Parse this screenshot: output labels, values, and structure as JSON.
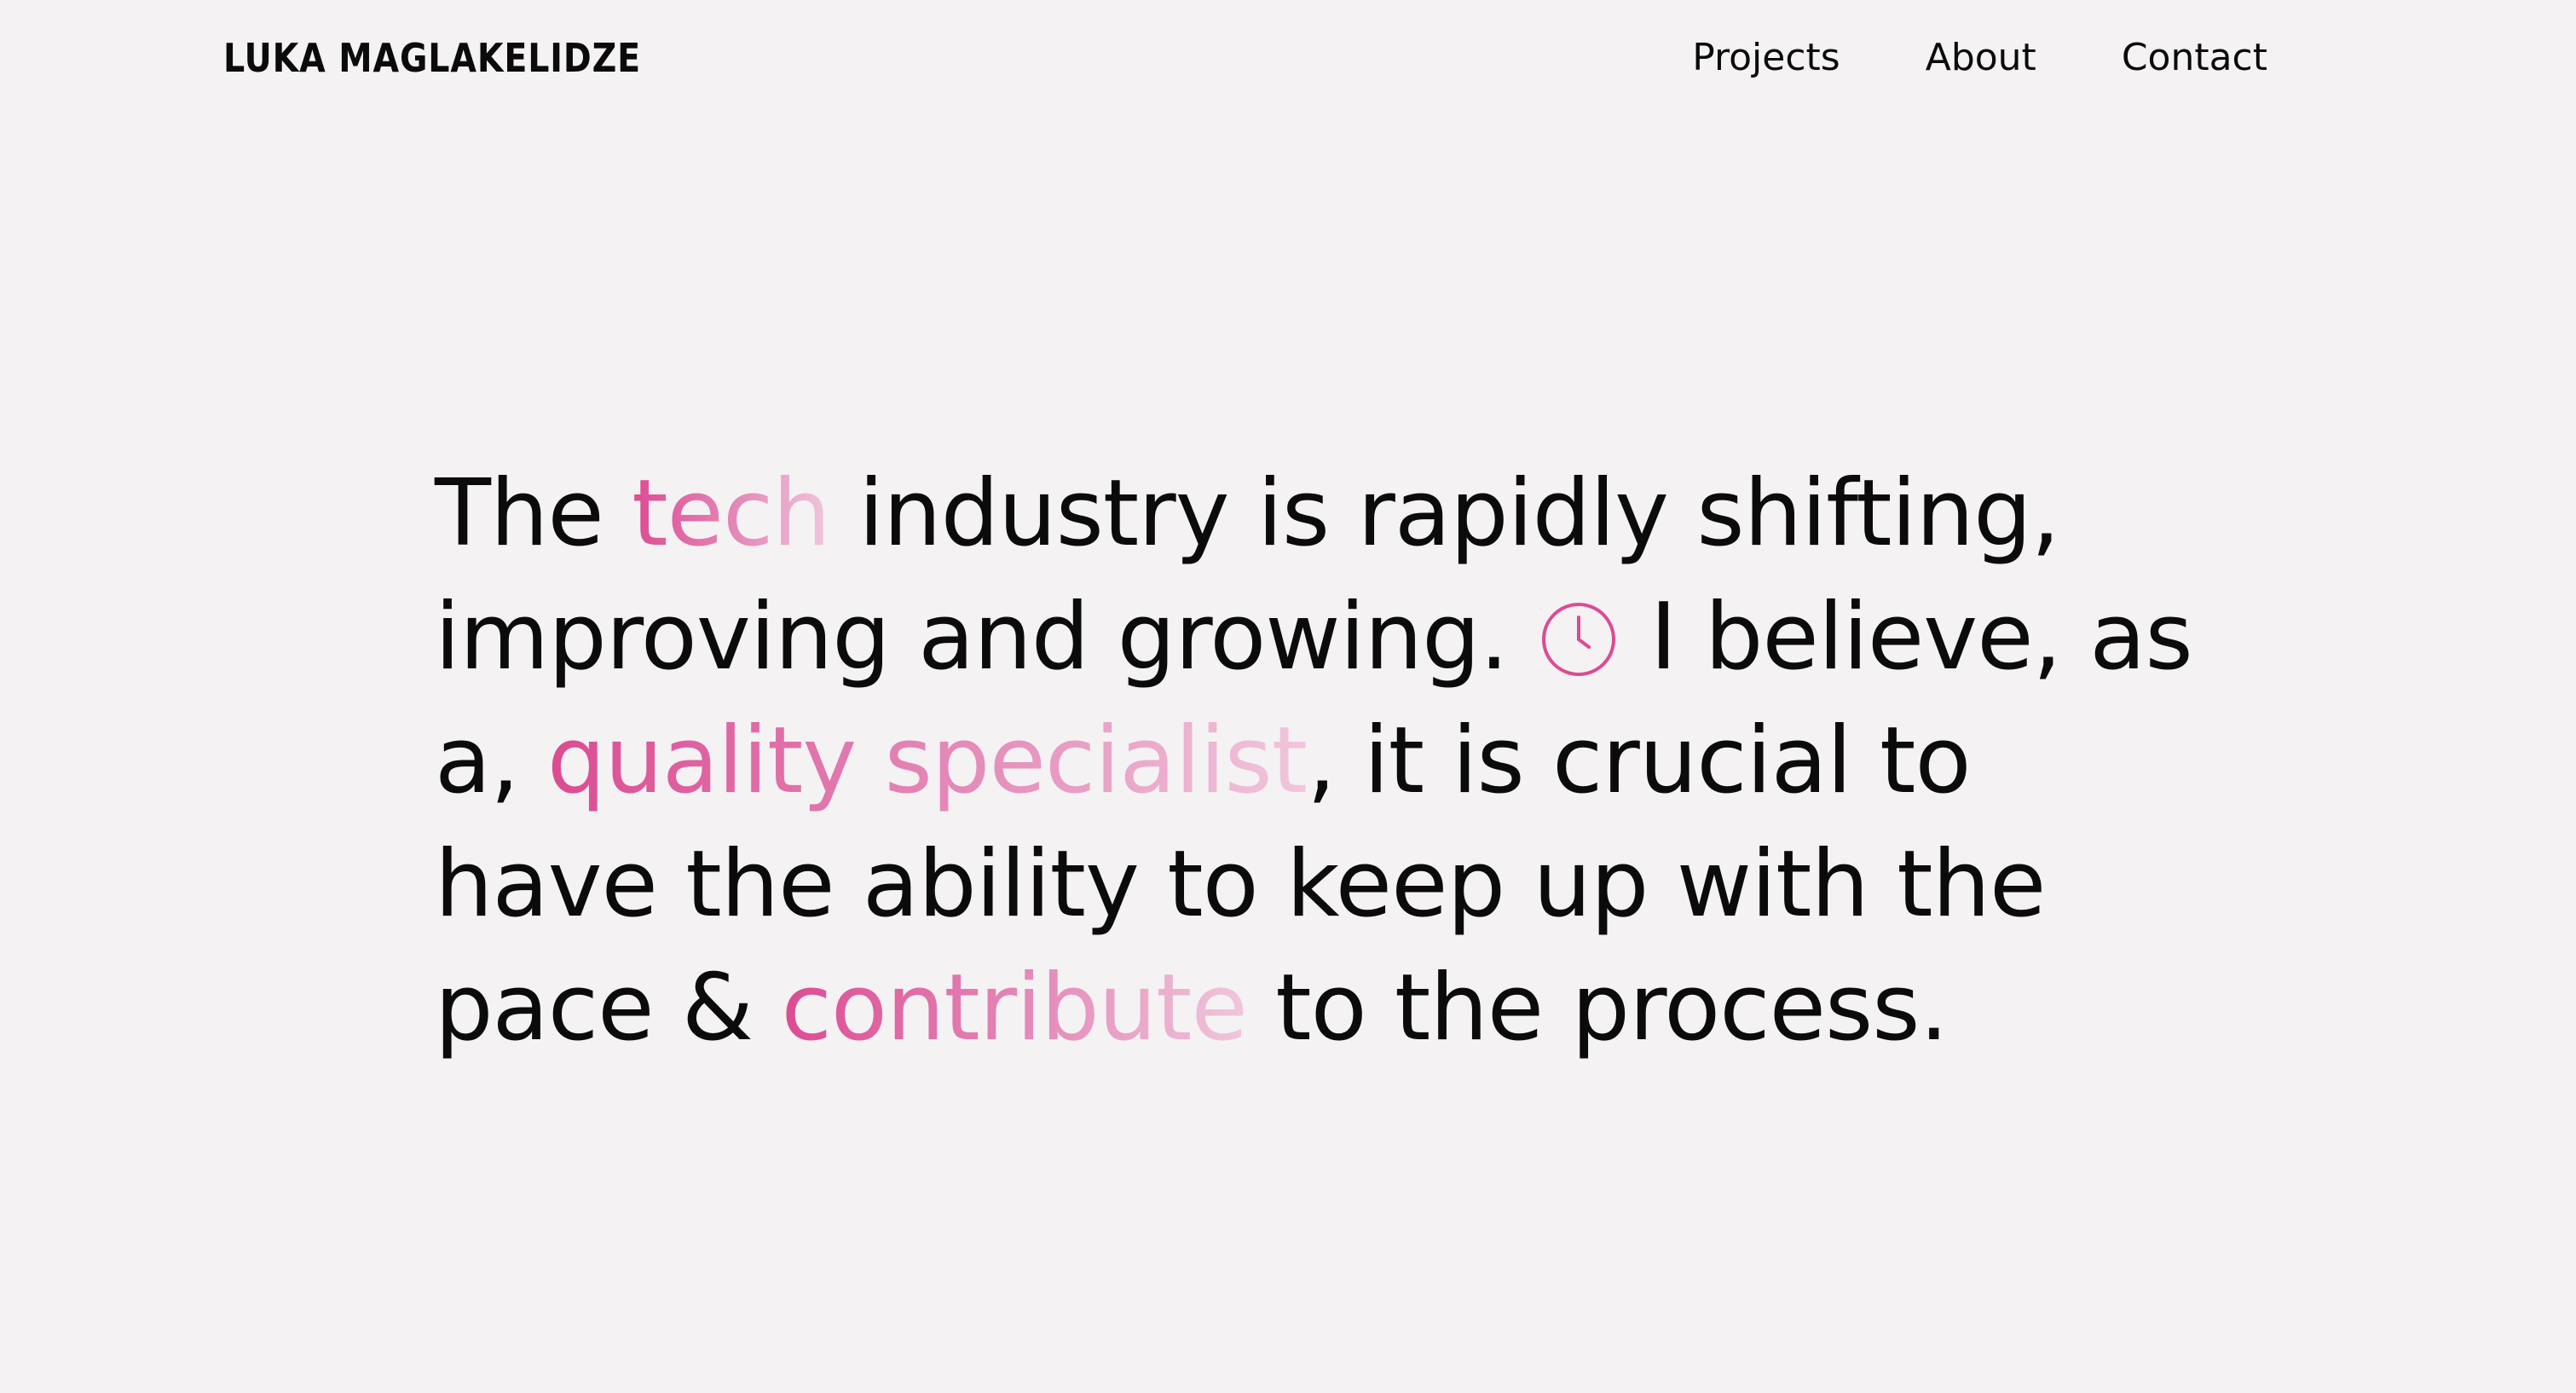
{
  "header": {
    "logo": "LUKA MAGLAKELIDZE",
    "nav": [
      "Projects",
      "About",
      "Contact"
    ]
  },
  "hero": {
    "t1": "The ",
    "h1": "tech",
    "t2": " industry is rapidly shifting, improving and growing. ",
    "t3": " I believe, as a, ",
    "h2": "quality specialist",
    "t4": ", it is crucial to have the ability to keep up with the pace & ",
    "h3": "contribute",
    "t5": " to the process."
  },
  "icons": {
    "clock": "clock-icon"
  },
  "colors": {
    "background": "#f4f2f3",
    "text": "#0b0b0b",
    "accent": "#dc4b92",
    "accent_light": "#f1c6dc"
  }
}
